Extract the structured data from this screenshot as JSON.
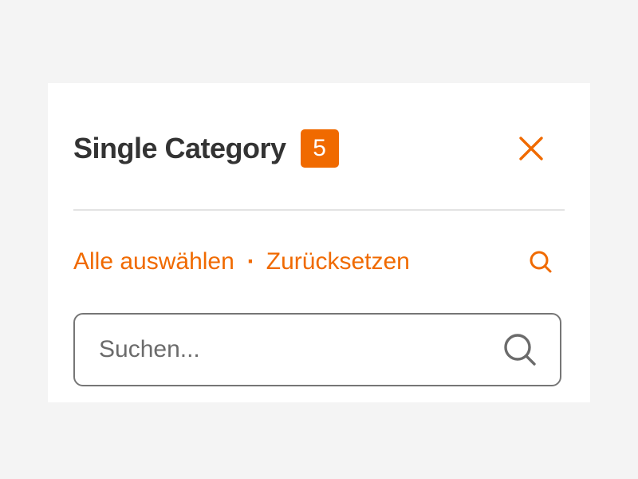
{
  "filter": {
    "title": "Single Category",
    "count": "5",
    "close_icon": "close-icon",
    "actions": {
      "select_all": "Alle auswählen",
      "separator": "·",
      "reset": "Zurücksetzen",
      "search_toggle_icon": "search-icon"
    },
    "search": {
      "value": "",
      "placeholder": "Suchen...",
      "icon": "search-icon"
    }
  },
  "colors": {
    "accent": "#f06a00",
    "title": "#333333",
    "divider": "#e3e3e3",
    "input_border": "#767676",
    "placeholder": "#6b6b6b",
    "background": "#f4f4f4",
    "panel": "#ffffff"
  }
}
